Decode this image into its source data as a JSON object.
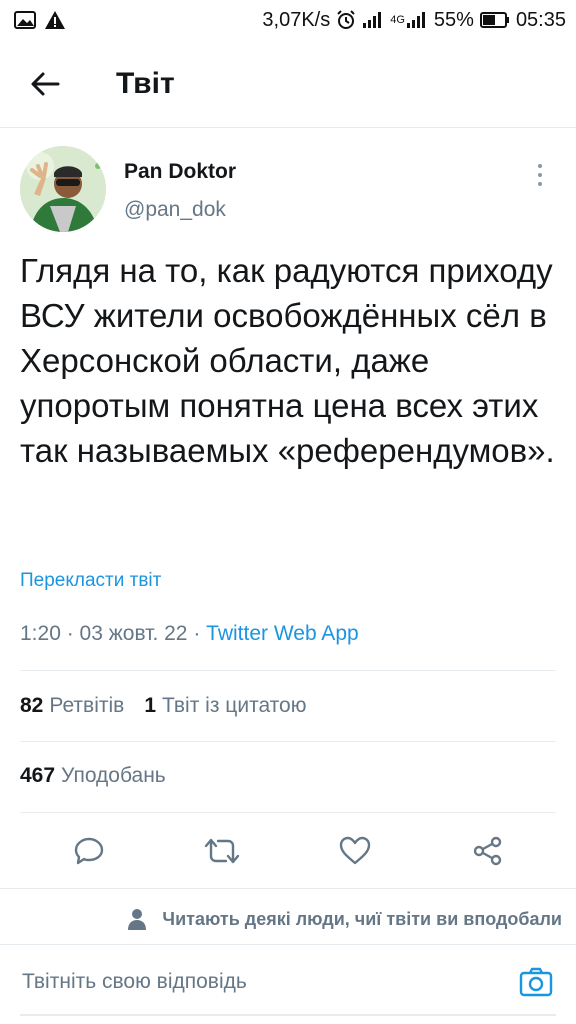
{
  "status_bar": {
    "speed": "3,07K/s",
    "network": "4G",
    "battery": "55%",
    "time": "05:35",
    "icons": [
      "image-icon",
      "warning-icon",
      "alarm-icon",
      "signal-icon",
      "signal-4g-icon",
      "battery-icon"
    ]
  },
  "app_bar": {
    "title": "Твіт",
    "back_icon": "arrow-left-icon"
  },
  "tweet": {
    "author_name": "Pan Doktor",
    "author_handle": "@pan_dok",
    "text": "Глядя на то, как радуются приходу ВСУ жители освобождённых сёл в Херсонской области, даже упоротым понятна цена всех этих так называемых «референдумов».",
    "translate_label": "Перекласти твіт",
    "time": "1:20",
    "date": "03 жовт. 22",
    "source": "Twitter Web App",
    "separator": " · "
  },
  "stats": {
    "retweets_count": "82",
    "retweets_label": "Ретвітів",
    "quotes_count": "1",
    "quotes_label": "Твіт із цитатою",
    "likes_count": "467",
    "likes_label": "Уподобань"
  },
  "actions": [
    {
      "name": "reply",
      "icon": "comment-icon"
    },
    {
      "name": "retweet",
      "icon": "retweet-icon"
    },
    {
      "name": "like",
      "icon": "heart-icon"
    },
    {
      "name": "share",
      "icon": "share-icon"
    }
  ],
  "notice": {
    "text": "Читають деякі люди, чиї твіти ви вподобали",
    "icon": "person-icon"
  },
  "reply": {
    "placeholder": "Твітніть свою відповідь",
    "camera_icon": "camera-icon"
  },
  "colors": {
    "accent": "#1b95e0",
    "text": "#14171a",
    "secondary": "#657786",
    "divider": "#e6ecf0"
  }
}
